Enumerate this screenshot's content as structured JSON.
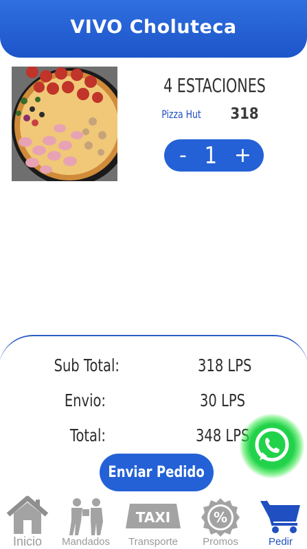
{
  "header": {
    "title": "VIVO Choluteca"
  },
  "product": {
    "name": "4 ESTACIONES",
    "brand": "Pizza Hut",
    "price": "318",
    "quantity": "1",
    "decrement_label": "-",
    "increment_label": "+"
  },
  "summary": {
    "subtotal_label": "Sub Total:",
    "subtotal_value": "318 LPS",
    "shipping_label": "Envio:",
    "shipping_value": "30 LPS",
    "total_label": "Total:",
    "total_value": "348 LPS",
    "send_button": "Enviar Pedido"
  },
  "nav": {
    "items": [
      {
        "label": "Inicio",
        "icon": "home-icon"
      },
      {
        "label": "Mandados",
        "icon": "delivery-icon"
      },
      {
        "label": "Transporte",
        "icon": "taxi-icon",
        "badge": "TAXI"
      },
      {
        "label": "Promos",
        "icon": "promo-icon",
        "badge": "%"
      },
      {
        "label": "Pedir",
        "icon": "cart-icon"
      }
    ],
    "active_color": "#1f4fc0",
    "inactive_color": "#9a9a9a"
  },
  "colors": {
    "primary": "#2461d6",
    "whatsapp": "#22d24a"
  }
}
